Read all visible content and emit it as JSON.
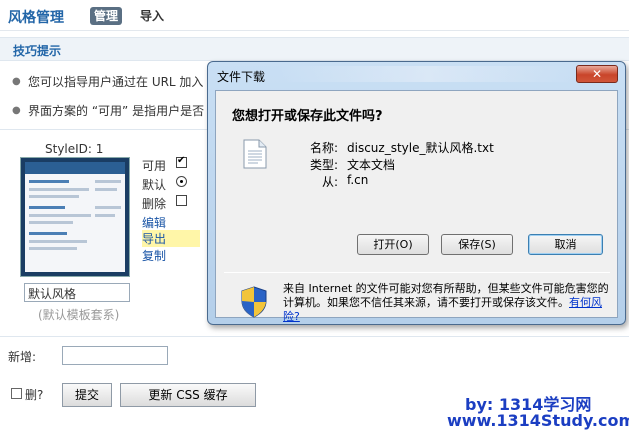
{
  "header": {
    "title": "风格管理",
    "tabs": [
      {
        "label": "管理",
        "active": true
      },
      {
        "label": "导入",
        "active": false
      }
    ]
  },
  "tips": {
    "title": "技巧提示",
    "items": [
      "您可以指导用户通过在 URL 加入",
      "界面方案的 “可用” 是指用户是否"
    ]
  },
  "style_item": {
    "style_id": "StyleID: 1",
    "options": [
      {
        "label": "可用",
        "control": "checkbox",
        "checked": true
      },
      {
        "label": "默认",
        "control": "radio",
        "checked": true
      },
      {
        "label": "删除",
        "control": "checkbox",
        "checked": false
      }
    ],
    "links": [
      "编辑",
      "导出",
      "复制"
    ],
    "name_value": "默认风格",
    "name_sub": "(默认模板套系)"
  },
  "new_row": {
    "label": "新增:"
  },
  "footer": {
    "delete_label": "删?",
    "submit_label": "提交",
    "update_css_label": "更新 CSS 缓存"
  },
  "watermark": {
    "line1": "by:  1314学习网",
    "line2": "www.1314Study.com"
  },
  "dialog": {
    "title": "文件下载",
    "close_icon": "close-icon",
    "question": "您想打开或保存此文件吗?",
    "fields": [
      {
        "label": "名称:",
        "value": "discuz_style_默认风格.txt"
      },
      {
        "label": "类型:",
        "value": "文本文档"
      },
      {
        "label": "从:",
        "value": "f.cn"
      }
    ],
    "buttons": {
      "open": "打开(O)",
      "save": "保存(S)",
      "cancel": "取消"
    },
    "warning_text": "来自 Internet 的文件可能对您有所帮助，但某些文件可能危害您的计算机。如果您不信任其来源，请不要打开或保存该文件。",
    "warning_link": "有何风险?"
  }
}
